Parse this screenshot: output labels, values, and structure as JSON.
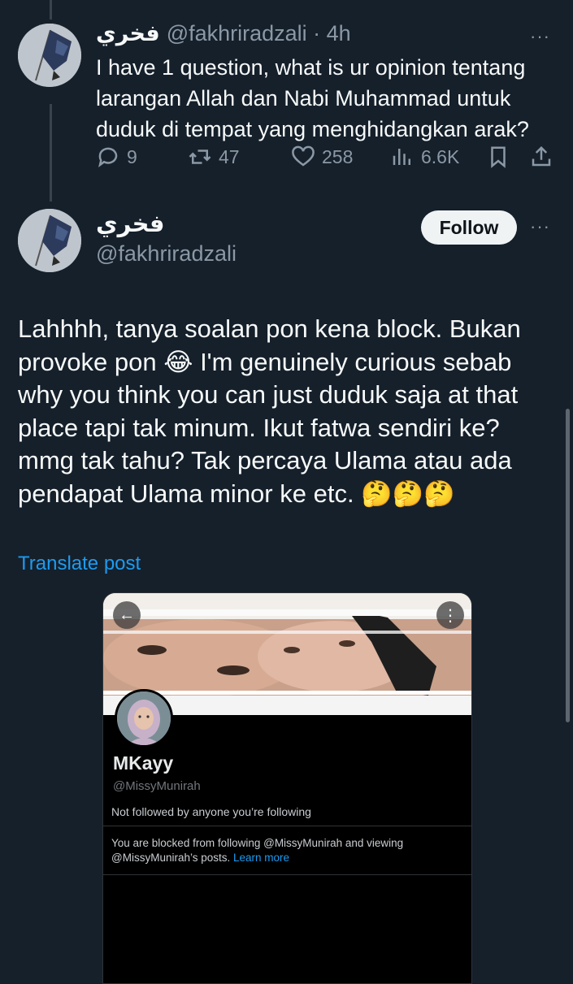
{
  "reply": {
    "author_name": "فخري",
    "handle_time": "@fakhriradzali · 4h",
    "text": "I have 1 question, what is ur opinion tentang larangan Allah dan Nabi Muhammad untuk duduk di tempat yang menghidangkan arak?",
    "actions": {
      "replies": "9",
      "reposts": "47",
      "likes": "258",
      "views": "6.6K"
    },
    "more": "···"
  },
  "post": {
    "author_name": "فخري",
    "handle": "@fakhriradzali",
    "follow_label": "Follow",
    "more": "···",
    "text": "Lahhhh, tanya soalan pon kena block. Bukan provoke pon 😂 I'm genuinely curious sebab why you think you can just duduk saja at that place tapi tak minum. Ikut fatwa sendiri ke? mmg tak tahu? Tak percaya Ulama atau ada pendapat Ulama minor ke etc. 🤔🤔🤔",
    "translate_label": "Translate post"
  },
  "screenshot_card": {
    "back_icon": "←",
    "menu_icon": "⋮",
    "profile_name": "MKayy",
    "profile_handle": "@MissyMunirah",
    "followed_note": "Not followed by anyone you’re following",
    "blocked_text": "You are blocked from following @MissyMunirah and viewing @MissyMunirah’s posts.",
    "learn_more": "Learn more"
  },
  "colors": {
    "background": "#15202b",
    "accent": "#1d9bf0",
    "muted": "#8b98a5",
    "text": "#f7f9f9"
  },
  "icons": [
    "reply-icon",
    "repost-icon",
    "like-icon",
    "views-icon",
    "bookmark-icon",
    "share-icon",
    "back-arrow-icon",
    "kebab-menu-icon"
  ]
}
